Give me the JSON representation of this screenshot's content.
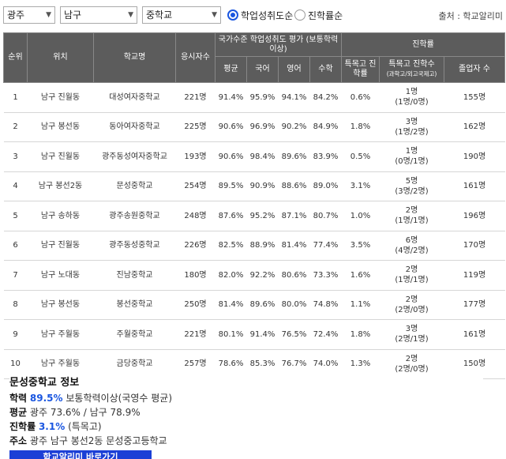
{
  "filters": {
    "region": "광주",
    "district": "남구",
    "school_type": "중학교",
    "sort_options": [
      {
        "label": "학업성취도순",
        "selected": true
      },
      {
        "label": "진학률순",
        "selected": false
      }
    ],
    "source": "출처 : 학교알리미"
  },
  "table": {
    "headers": {
      "rank": "순위",
      "location": "위치",
      "school": "학교명",
      "examinees": "응시자수",
      "achievement_group": "국가수준 학업성취도 평가 (보통학력이상)",
      "admission_group": "진학률",
      "average": "평균",
      "korean": "국어",
      "english": "영어",
      "math": "수학",
      "special_rate": "특목고 진학률",
      "special_count": "특목고 진학수",
      "special_count_sub": "(과학고/외고국제고)",
      "graduates": "졸업자 수"
    },
    "rows": [
      {
        "rank": "1",
        "location": "남구 진월동",
        "school": "대성여자중학교",
        "examinees": "221명",
        "average": "91.4%",
        "korean": "95.9%",
        "english": "94.1%",
        "math": "84.2%",
        "special_rate": "0.6%",
        "special_count": "1명",
        "special_detail": "(1명/0명)",
        "graduates": "155명"
      },
      {
        "rank": "2",
        "location": "남구 봉선동",
        "school": "동아여자중학교",
        "examinees": "225명",
        "average": "90.6%",
        "korean": "96.9%",
        "english": "90.2%",
        "math": "84.9%",
        "special_rate": "1.8%",
        "special_count": "3명",
        "special_detail": "(1명/2명)",
        "graduates": "162명"
      },
      {
        "rank": "3",
        "location": "남구 진월동",
        "school": "광주동성여자중학교",
        "examinees": "193명",
        "average": "90.6%",
        "korean": "98.4%",
        "english": "89.6%",
        "math": "83.9%",
        "special_rate": "0.5%",
        "special_count": "1명",
        "special_detail": "(0명/1명)",
        "graduates": "190명"
      },
      {
        "rank": "4",
        "location": "남구 봉선2동",
        "school": "문성중학교",
        "examinees": "254명",
        "average": "89.5%",
        "korean": "90.9%",
        "english": "88.6%",
        "math": "89.0%",
        "special_rate": "3.1%",
        "special_count": "5명",
        "special_detail": "(3명/2명)",
        "graduates": "161명"
      },
      {
        "rank": "5",
        "location": "남구 송하동",
        "school": "광주송원중학교",
        "examinees": "248명",
        "average": "87.6%",
        "korean": "95.2%",
        "english": "87.1%",
        "math": "80.7%",
        "special_rate": "1.0%",
        "special_count": "2명",
        "special_detail": "(1명/1명)",
        "graduates": "196명"
      },
      {
        "rank": "6",
        "location": "남구 진월동",
        "school": "광주동성중학교",
        "examinees": "226명",
        "average": "82.5%",
        "korean": "88.9%",
        "english": "81.4%",
        "math": "77.4%",
        "special_rate": "3.5%",
        "special_count": "6명",
        "special_detail": "(4명/2명)",
        "graduates": "170명"
      },
      {
        "rank": "7",
        "location": "남구 노대동",
        "school": "진남중학교",
        "examinees": "180명",
        "average": "82.0%",
        "korean": "92.2%",
        "english": "80.6%",
        "math": "73.3%",
        "special_rate": "1.6%",
        "special_count": "2명",
        "special_detail": "(1명/1명)",
        "graduates": "119명"
      },
      {
        "rank": "8",
        "location": "남구 봉선동",
        "school": "봉선중학교",
        "examinees": "250명",
        "average": "81.4%",
        "korean": "89.6%",
        "english": "80.0%",
        "math": "74.8%",
        "special_rate": "1.1%",
        "special_count": "2명",
        "special_detail": "(2명/0명)",
        "graduates": "177명"
      },
      {
        "rank": "9",
        "location": "남구 주월동",
        "school": "주월중학교",
        "examinees": "221명",
        "average": "80.1%",
        "korean": "91.4%",
        "english": "76.5%",
        "math": "72.4%",
        "special_rate": "1.8%",
        "special_count": "3명",
        "special_detail": "(2명/1명)",
        "graduates": "161명"
      },
      {
        "rank": "10",
        "location": "남구 주월동",
        "school": "금당중학교",
        "examinees": "257명",
        "average": "78.6%",
        "korean": "85.3%",
        "english": "76.7%",
        "math": "74.0%",
        "special_rate": "1.3%",
        "special_count": "2명",
        "special_detail": "(2명/0명)",
        "graduates": "150명"
      }
    ]
  },
  "info": {
    "title": "문성중학교 정보",
    "achievement_label": "학력",
    "achievement_value": "89.5%",
    "achievement_desc": "보통학력이상(국영수 평균)",
    "average_label": "평균",
    "average_text": "광주 73.6% / 남구 78.9%",
    "admission_label": "진학률",
    "admission_value": "3.1%",
    "admission_desc": "(특목고)",
    "address_label": "주소",
    "address_text": "광주 남구 봉선2동 문성중고등학교",
    "button_label": "학교알리미 바로가기"
  },
  "colors": {
    "header_bg": "#5c5c5c",
    "accent_blue": "#1a56e0",
    "button_bg": "#1b3fd6"
  }
}
